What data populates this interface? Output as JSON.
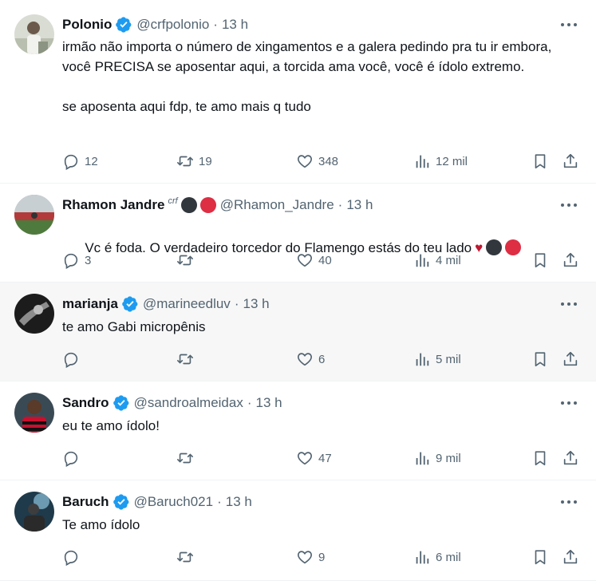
{
  "tweets": [
    {
      "name": "Polonio",
      "verified": true,
      "handle": "@crfpolonio",
      "time": "13 h",
      "text": "irmão não importa o número de xingamentos e a galera pedindo pra tu ir embora, você PRECISA se aposentar aqui, a torcida ama você, você é ídolo extremo.\n\nse aposenta aqui fdp, te amo mais q tudo",
      "replies": "12",
      "reposts": "19",
      "likes": "348",
      "views": "12 mil",
      "avatar_icon": "person-portrait-icon"
    },
    {
      "name": "Rhamon Jandre",
      "affiliate_badge": "crf",
      "name_emoji": [
        "black-circle",
        "red-circle"
      ],
      "handle": "@Rhamon_Jandre",
      "time": "13 h",
      "text": "Vc é foda. O verdadeiro torcedor do Flamengo estás do teu lado",
      "text_emoji": [
        "heart",
        "black-circle",
        "red-circle"
      ],
      "replies": "3",
      "reposts": "",
      "likes": "40",
      "views": "4 mil",
      "avatar_icon": "stadium-photo-icon"
    },
    {
      "name": "marianja",
      "verified": true,
      "handle": "@marineedluv",
      "time": "13 h",
      "text": "te amo Gabi micropênis",
      "replies": "",
      "reposts": "",
      "likes": "6",
      "views": "5 mil",
      "avatar_icon": "black-white-photo-icon"
    },
    {
      "name": "Sandro",
      "verified": true,
      "handle": "@sandroalmeidax",
      "time": "13 h",
      "text": "eu te amo ídolo!",
      "replies": "",
      "reposts": "",
      "likes": "47",
      "views": "9 mil",
      "avatar_icon": "player-photo-icon"
    },
    {
      "name": "Baruch",
      "verified": true,
      "handle": "@Baruch021",
      "time": "13 h",
      "text": "Te amo ídolo",
      "replies": "",
      "reposts": "",
      "likes": "9",
      "views": "6 mil",
      "avatar_icon": "stage-photo-icon"
    }
  ],
  "colors": {
    "text": "#0f1419",
    "secondary": "#536471",
    "verified": "#1d9bf0",
    "highlight_bg": "#f7f7f7",
    "border": "#eff3f4",
    "flamengo_red": "#dd2e44",
    "flamengo_black": "#31373d"
  }
}
